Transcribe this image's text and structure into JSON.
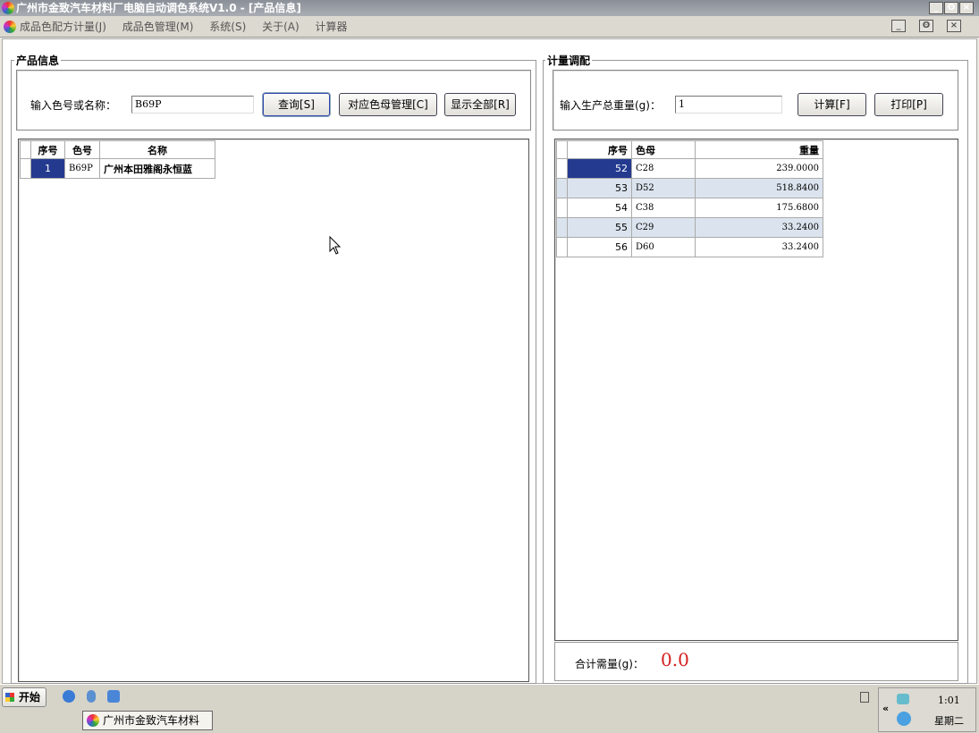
{
  "window": {
    "title": "广州市金致汽车材料厂电脑自动调色系统V1.0 - [产品信息]",
    "controls": [
      "_",
      "ʘ",
      "×"
    ]
  },
  "menu": [
    "成品色配方计量(J)",
    "成品色管理(M)",
    "系统(S)",
    "关于(A)",
    "计算器"
  ],
  "product": {
    "group_title": "产品信息",
    "search_label": "输入色号或名称：",
    "search_value": "B69P",
    "buttons": {
      "query": "查询[S]",
      "manage": "对应色母管理[C]",
      "show_all": "显示全部[R]"
    },
    "columns": [
      "序号",
      "色号",
      "名称"
    ],
    "rows": [
      {
        "no": "1",
        "code": "B69P",
        "name": "广州本田雅阁永恒蓝"
      }
    ]
  },
  "metering": {
    "group_title": "计量调配",
    "weight_label": "输入生产总重量(g)：",
    "weight_value": "1",
    "buttons": {
      "calc": "计算[F]",
      "print": "打印[P]"
    },
    "columns": [
      "序号",
      "色母",
      "重量"
    ],
    "rows": [
      {
        "no": "52",
        "base": "C28",
        "weight": "239.0000"
      },
      {
        "no": "53",
        "base": "D52",
        "weight": "518.8400"
      },
      {
        "no": "54",
        "base": "C38",
        "weight": "175.6800"
      },
      {
        "no": "55",
        "base": "C29",
        "weight": "33.2400"
      },
      {
        "no": "56",
        "base": "D60",
        "weight": "33.2400"
      }
    ],
    "total_label": "合计需量(g)：",
    "total_value": "0.0",
    "total_color": "#d42020"
  },
  "taskbar": {
    "start": "开始",
    "task": "广州市金致汽车材料厂...",
    "time": "1:01",
    "day": "星期二"
  }
}
